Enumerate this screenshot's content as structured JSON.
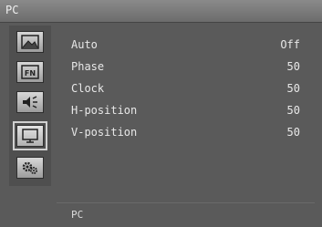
{
  "header": {
    "title": "PC"
  },
  "sidebar": {
    "items": [
      {
        "icon": "picture-icon"
      },
      {
        "icon": "function-icon",
        "label": "FN"
      },
      {
        "icon": "audio-icon"
      },
      {
        "icon": "pc-monitor-icon",
        "active": true
      },
      {
        "icon": "settings-gears-icon"
      }
    ]
  },
  "menu": {
    "items": [
      {
        "label": "Auto",
        "value": "Off"
      },
      {
        "label": "Phase",
        "value": "50"
      },
      {
        "label": "Clock",
        "value": "50"
      },
      {
        "label": "H-position",
        "value": "50"
      },
      {
        "label": "V-position",
        "value": "50"
      }
    ]
  },
  "footer": {
    "text": "PC"
  }
}
